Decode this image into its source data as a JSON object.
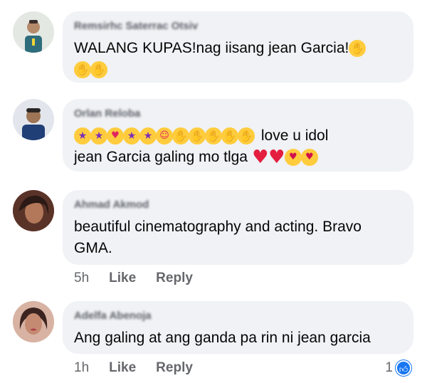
{
  "comments": [
    {
      "author": "Remsirhc Saterrac Otsiv",
      "line1": "WALANG KUPAS!nag iisang jean Garcia!",
      "line1_emojis": [
        "clap"
      ],
      "line2_emojis": [
        "clap",
        "clap"
      ]
    },
    {
      "author": "Orlan Reloba",
      "line1_emojis": [
        "star-struck",
        "star-struck",
        "heart-eyes",
        "star-struck",
        "star-struck",
        "smiling-face-with-hearts",
        "clap",
        "clap",
        "clap",
        "clap",
        "clap"
      ],
      "line1": "love u idol",
      "line2": "jean Garcia galing mo tlga",
      "line2_emojis": [
        "heart",
        "heart",
        "kiss",
        "kiss"
      ]
    },
    {
      "author": "Ahmad Akmod",
      "line1": "beautiful cinematography and acting. Bravo",
      "line2": "GMA.",
      "time": "5h",
      "like": "Like",
      "reply": "Reply"
    },
    {
      "author": "Adelfa Abenoja",
      "line1": "Ang galing at ang ganda pa rin ni jean garcia",
      "time": "1h",
      "like": "Like",
      "reply": "Reply",
      "reaction_count": "1"
    }
  ],
  "colors": {
    "bubble": "#f0f2f5",
    "meta_text": "#65676b",
    "like_blue": "#1877f2",
    "heart_red": "#e41e3f",
    "emoji_yellow": "#ffcc3d"
  }
}
